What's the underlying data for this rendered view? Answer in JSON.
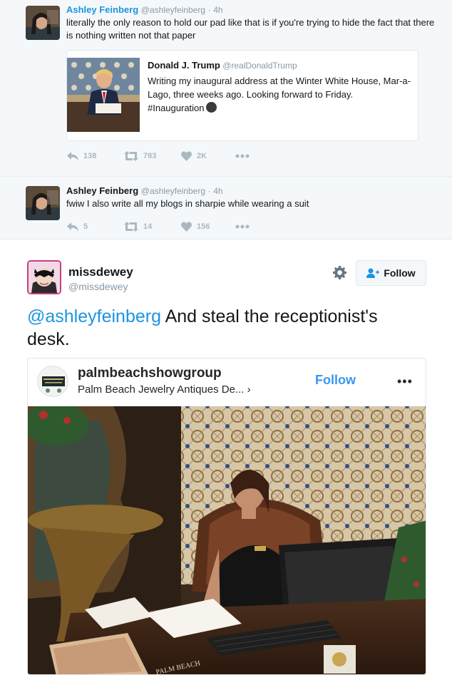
{
  "thread": {
    "tweets": [
      {
        "name": "Ashley Feinberg",
        "handle": "@ashleyfeinberg",
        "dot": "·",
        "time": "4h",
        "text": "literally the only reason to hold our pad like that is if you're trying to hide the fact that there is nothing written not that paper",
        "quote": {
          "name": "Donald J. Trump",
          "handle": "@realDonaldTrump",
          "text": "Writing my inaugural address at the Winter White House, Mar-a-Lago, three weeks ago. Looking forward to Friday. #Inauguration"
        },
        "actions": {
          "replies": "138",
          "retweets": "783",
          "likes": "2K"
        }
      },
      {
        "name": "Ashley Feinberg",
        "handle": "@ashleyfeinberg",
        "dot": "·",
        "time": "4h",
        "text": "fwiw I also write all my blogs in sharpie while wearing a suit",
        "actions": {
          "replies": "5",
          "retweets": "14",
          "likes": "156"
        }
      }
    ]
  },
  "embed": {
    "name": "missdewey",
    "handle": "@missdewey",
    "follow_label": "Follow",
    "mention": "@ashleyfeinberg",
    "text": " And steal the receptionist's desk.",
    "instagram": {
      "username": "palmbeachshowgroup",
      "location": "Palm Beach Jewelry Antiques De... ›",
      "follow_label": "Follow",
      "more": "•••",
      "photo_sign": "PALM BEACH"
    }
  },
  "colors": {
    "link_blue": "#1b95e0",
    "instagram_blue": "#3897f0",
    "muted_gray": "#8899a6",
    "thread_bg": "#f5f8fa"
  }
}
